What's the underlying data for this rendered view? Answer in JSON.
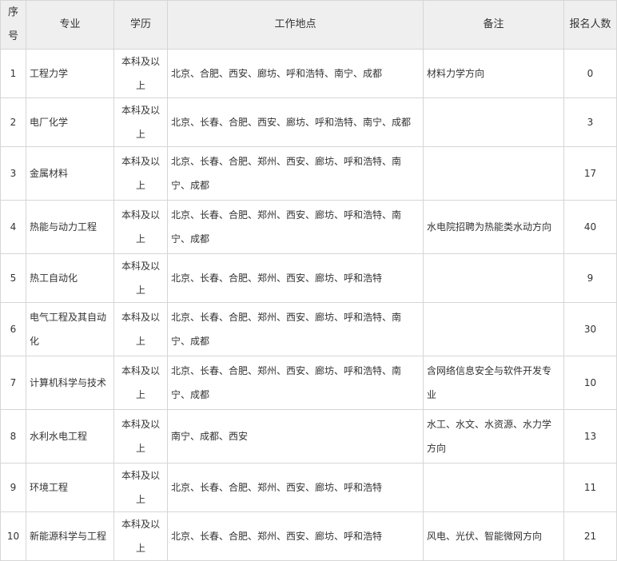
{
  "headers": [
    "序号",
    "专业",
    "学历",
    "工作地点",
    "备注",
    "报名人数"
  ],
  "rows": [
    {
      "no": "1",
      "major": "工程力学",
      "edu": "本科及以上",
      "location": "北京、合肥、西安、廊坊、呼和浩特、南宁、成都",
      "note": "材料力学方向",
      "count": "0"
    },
    {
      "no": "2",
      "major": "电厂化学",
      "edu": "本科及以上",
      "location": "北京、长春、合肥、西安、廊坊、呼和浩特、南宁、成都",
      "note": "",
      "count": "3"
    },
    {
      "no": "3",
      "major": "金属材料",
      "edu": "本科及以上",
      "location": "北京、长春、合肥、郑州、西安、廊坊、呼和浩特、南宁、成都",
      "note": "",
      "count": "17"
    },
    {
      "no": "4",
      "major": "热能与动力工程",
      "edu": "本科及以上",
      "location": "北京、长春、合肥、郑州、西安、廊坊、呼和浩特、南宁、成都",
      "note": "水电院招聘为热能类水动方向",
      "count": "40"
    },
    {
      "no": "5",
      "major": "热工自动化",
      "edu": "本科及以上",
      "location": "北京、长春、合肥、郑州、西安、廊坊、呼和浩特",
      "note": "",
      "count": "9"
    },
    {
      "no": "6",
      "major": "电气工程及其自动化",
      "edu": "本科及以上",
      "location": "北京、长春、合肥、郑州、西安、廊坊、呼和浩特、南宁、成都",
      "note": "",
      "count": "30"
    },
    {
      "no": "7",
      "major": "计算机科学与技术",
      "edu": "本科及以上",
      "location": "北京、长春、合肥、郑州、西安、廊坊、呼和浩特、南宁、成都",
      "note": "含网络信息安全与软件开发专业",
      "count": "10"
    },
    {
      "no": "8",
      "major": "水利水电工程",
      "edu": "本科及以上",
      "location": "南宁、成都、西安",
      "note": "水工、水文、水资源、水力学方向",
      "count": "13"
    },
    {
      "no": "9",
      "major": "环境工程",
      "edu": "本科及以上",
      "location": "北京、长春、合肥、郑州、西安、廊坊、呼和浩特",
      "note": "",
      "count": "11"
    },
    {
      "no": "10",
      "major": "新能源科学与工程",
      "edu": "本科及以上",
      "location": "北京、长春、合肥、郑州、西安、廊坊、呼和浩特",
      "note": "风电、光伏、智能微网方向",
      "count": "21"
    }
  ]
}
